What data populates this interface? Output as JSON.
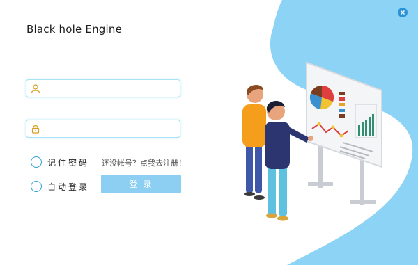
{
  "window": {
    "title": "Black hole Engine"
  },
  "form": {
    "username": {
      "value": "",
      "placeholder": "",
      "icon": "user-icon"
    },
    "password": {
      "value": "",
      "placeholder": "",
      "icon": "lock-icon"
    },
    "remember_label": "记住密码",
    "auto_login_label": "自动登录",
    "register_link": "还没帐号？点我去注册！",
    "login_button": "登录"
  },
  "colors": {
    "accent": "#2a95d6",
    "button": "#8ccff3",
    "background_shape": "#8dd3f5",
    "field_border": "#a9e4f5"
  }
}
